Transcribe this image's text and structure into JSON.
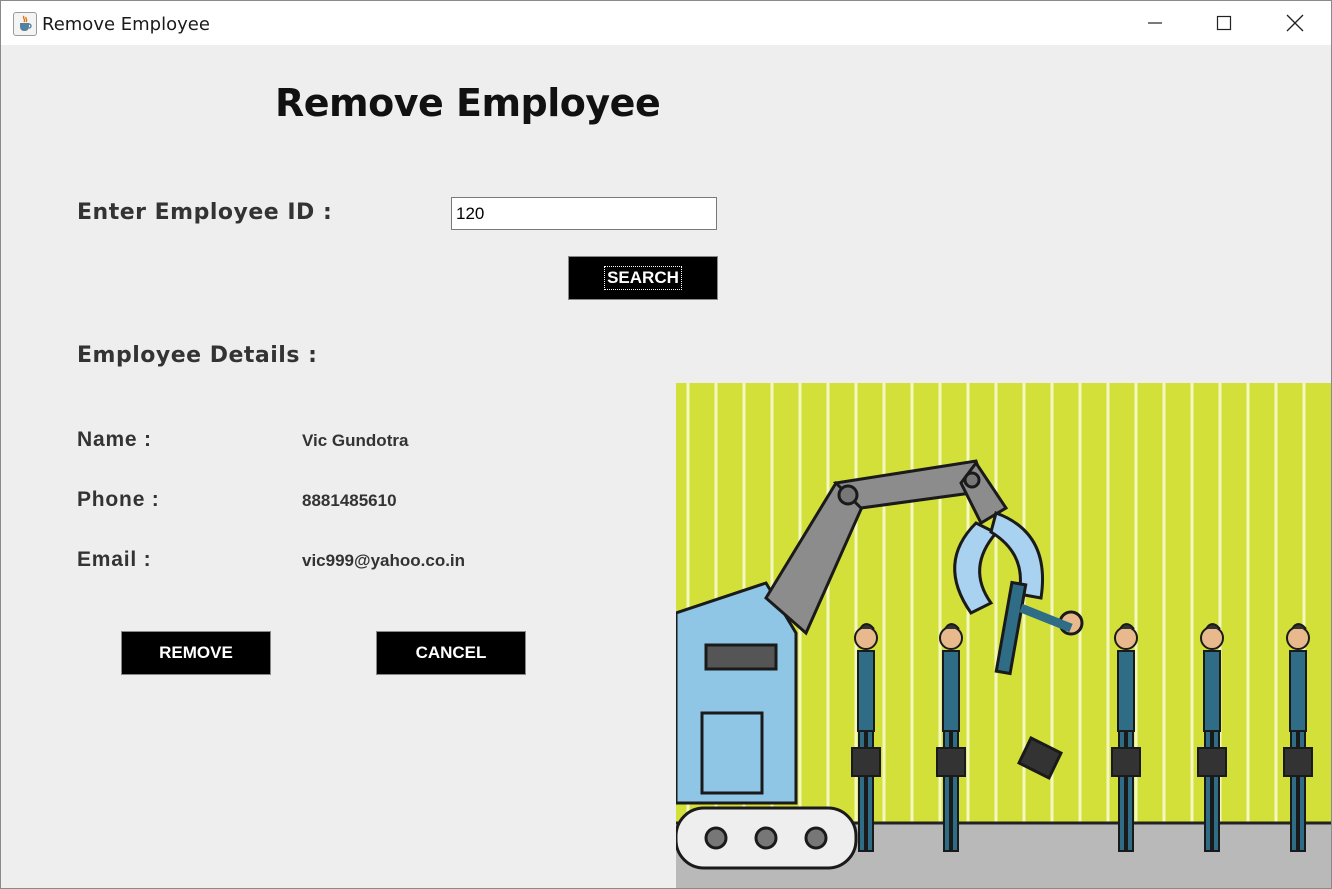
{
  "window": {
    "title": "Remove Employee",
    "app_icon": "java-cup-icon",
    "controls": [
      "minimize-icon",
      "maximize-icon",
      "close-icon"
    ]
  },
  "form": {
    "heading": "Remove Employee",
    "employee_id_label": "Enter Employee ID :",
    "employee_id_value": "120",
    "search_label": "SEARCH",
    "details_heading": "Employee Details :",
    "fields": {
      "name_label": "Name :",
      "name_value": "Vic Gundotra",
      "phone_label": "Phone :",
      "phone_value": "8881485610",
      "email_label": "Email :",
      "email_value": "vic999@yahoo.co.in"
    },
    "remove_label": "REMOVE",
    "cancel_label": "CANCEL"
  },
  "colors": {
    "window_bg": "#eeeeee",
    "button_bg": "#000000",
    "button_text": "#ffffff",
    "illustration_bg": "#d4e03a"
  }
}
